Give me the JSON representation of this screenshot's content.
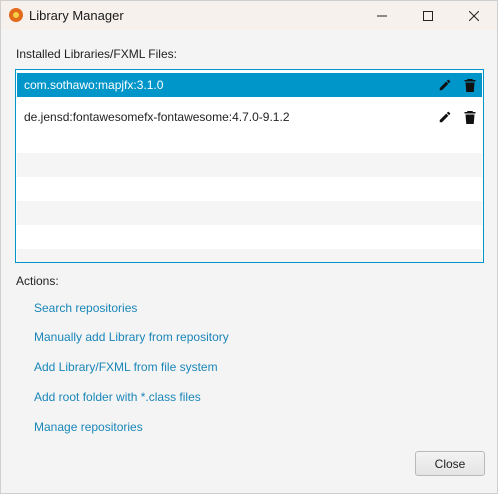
{
  "window": {
    "title": "Library Manager",
    "controls": {
      "minimize": "minimize",
      "maximize": "maximize",
      "close": "close"
    }
  },
  "installed_label": "Installed Libraries/FXML Files:",
  "libraries": [
    {
      "name": "com.sothawo:mapjfx:3.1.0",
      "selected": true
    },
    {
      "name": "de.jensd:fontawesomefx-fontawesome:4.7.0-9.1.2",
      "selected": false
    }
  ],
  "actions_label": "Actions:",
  "actions": [
    "Search repositories",
    "Manually add Library from repository",
    "Add Library/FXML from file system",
    "Add root folder with *.class files",
    "Manage repositories"
  ],
  "close_button": "Close",
  "colors": {
    "accent": "#0096c9",
    "link": "#1a86b8",
    "titlebar": "#f6f1ed"
  },
  "icons": {
    "row_edit": "pencil-icon",
    "row_delete": "trash-icon",
    "app": "app-icon"
  }
}
